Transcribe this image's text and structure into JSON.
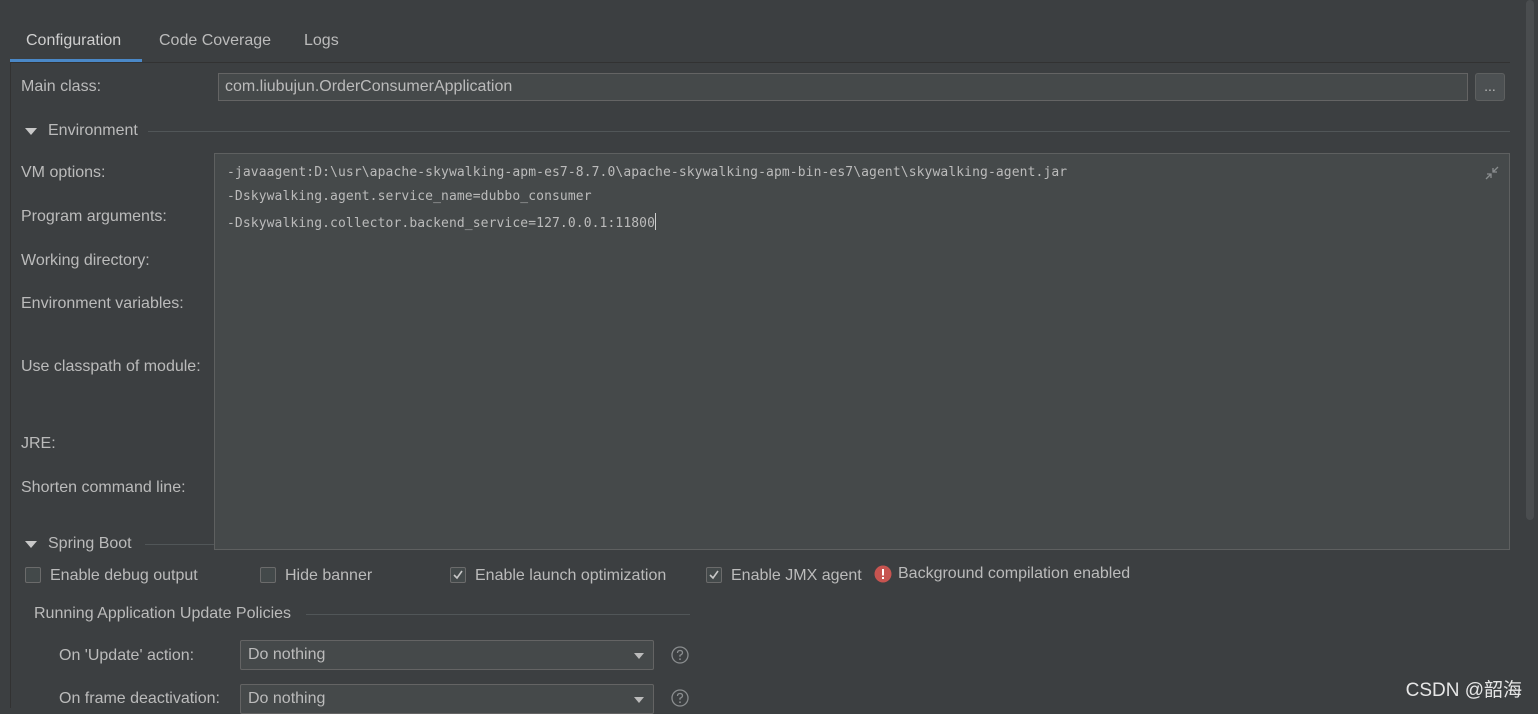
{
  "tabs": [
    {
      "label": "Configuration",
      "active": true
    },
    {
      "label": "Code Coverage",
      "active": false
    },
    {
      "label": "Logs",
      "active": false
    }
  ],
  "main_class": {
    "label": "Main class:",
    "value": "com.liubujun.OrderConsumerApplication",
    "browse_label": "..."
  },
  "environment": {
    "title": "Environment",
    "labels": {
      "vm_options": "VM options:",
      "program_arguments": "Program arguments:",
      "working_directory": "Working directory:",
      "environment_variables": "Environment variables:",
      "use_classpath": "Use classpath of module:",
      "jre": "JRE:",
      "shorten_command_line": "Shorten command line:"
    },
    "vm_options_lines": [
      "-javaagent:D:\\usr\\apache-skywalking-apm-es7-8.7.0\\apache-skywalking-apm-bin-es7\\agent\\skywalking-agent.jar",
      "-Dskywalking.agent.service_name=dubbo_consumer",
      "-Dskywalking.collector.backend_service=127.0.0.1:11800"
    ]
  },
  "spring_boot": {
    "title": "Spring Boot",
    "checkboxes": [
      {
        "label": "Enable debug output",
        "checked": false
      },
      {
        "label": "Hide banner",
        "checked": false
      },
      {
        "label": "Enable launch optimization",
        "checked": true
      },
      {
        "label": "Enable JMX agent",
        "checked": true
      }
    ],
    "warning": "Background compilation enabled",
    "policies_title": "Running Application Update Policies",
    "update_action": {
      "label": "On 'Update' action:",
      "value": "Do nothing"
    },
    "frame_deactivation": {
      "label": "On frame deactivation:",
      "value": "Do nothing"
    }
  },
  "watermark": "CSDN @韶海",
  "colors": {
    "background": "#3c3f41",
    "accent": "#4a88c7",
    "error": "#c75450"
  }
}
